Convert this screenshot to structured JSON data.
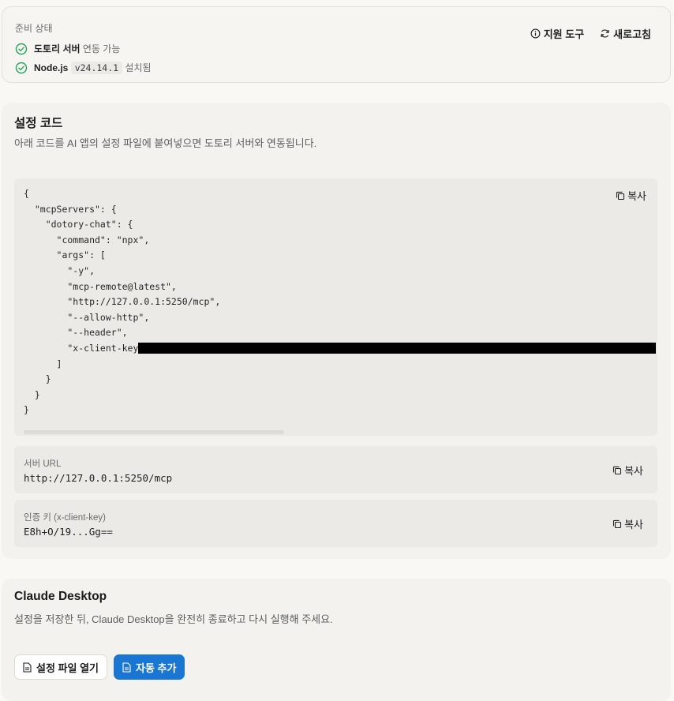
{
  "status": {
    "title": "준비 상태",
    "items": [
      {
        "name": "도토리 서버",
        "desc": "연동 가능"
      },
      {
        "name": "Node.js",
        "version": "v24.14.1",
        "desc": "설치됨"
      }
    ],
    "support_label": "지원 도구",
    "refresh_label": "새로고침"
  },
  "config": {
    "title": "설정 코드",
    "desc": "아래 코드를 AI 앱의 설정 파일에 붙여넣으면 도토리 서버와 연동됩니다.",
    "code": "{\n  \"mcpServers\": {\n    \"dotory-chat\": {\n      \"command\": \"npx\",\n      \"args\": [\n        \"-y\",\n        \"mcp-remote@latest\",\n        \"http://127.0.0.1:5250/mcp\",\n        \"--allow-http\",\n        \"--header\",\n        \"x-client-key:\n      ]\n    }\n  }\n}",
    "copy_label": "복사",
    "server_url": {
      "label": "서버 URL",
      "value": "http://127.0.0.1:5250/mcp",
      "copy_label": "복사"
    },
    "client_key": {
      "label": "인증 키 (x-client-key)",
      "value": "E8h+O/19...Gg==",
      "copy_label": "복사"
    }
  },
  "claude": {
    "title": "Claude Desktop",
    "desc": "설정을 저장한 뒤, Claude Desktop을 완전히 종료하고 다시 실행해 주세요.",
    "open_file_label": "설정 파일 열기",
    "auto_add_label": "자동 추가"
  },
  "colors": {
    "success": "#22a559",
    "primary": "#1976d2"
  },
  "icons": {
    "check": "check-circle-icon",
    "info": "info-icon",
    "refresh": "refresh-icon",
    "copy": "copy-icon",
    "file": "file-icon"
  }
}
